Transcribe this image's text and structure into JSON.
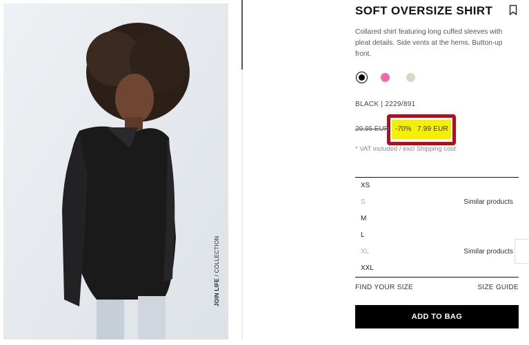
{
  "product": {
    "title": "SOFT OVERSIZE SHIRT",
    "description": "Collared shirt featuring long cuffed sleeves with pleat details. Side vents at the hems. Button-up front.",
    "color_code": "BLACK | 2229/891",
    "old_price": "29.95 EUR",
    "discount": "-70%",
    "new_price": "7.99 EUR",
    "vat_note": "* VAT included / excl Shipping cost"
  },
  "image": {
    "caption_bold": "JOIN LIFE",
    "caption_rest": " / COLLECTION"
  },
  "colors": [
    {
      "name": "black",
      "hex": "#000000",
      "selected": true
    },
    {
      "name": "pink",
      "hex": "#ef6aa8",
      "selected": false
    },
    {
      "name": "beige",
      "hex": "#ddd6c8",
      "selected": false
    }
  ],
  "sizes": [
    {
      "label": "XS",
      "available": true,
      "note": ""
    },
    {
      "label": "S",
      "available": false,
      "note": "Similar products"
    },
    {
      "label": "M",
      "available": true,
      "note": ""
    },
    {
      "label": "L",
      "available": true,
      "note": ""
    },
    {
      "label": "XL",
      "available": false,
      "note": "Similar products"
    },
    {
      "label": "XXL",
      "available": true,
      "note": ""
    }
  ],
  "actions": {
    "find_size": "FIND YOUR SIZE",
    "size_guide": "SIZE GUIDE",
    "add_to_bag": "ADD TO BAG"
  },
  "icons": {
    "bookmark": "bookmark-icon"
  }
}
